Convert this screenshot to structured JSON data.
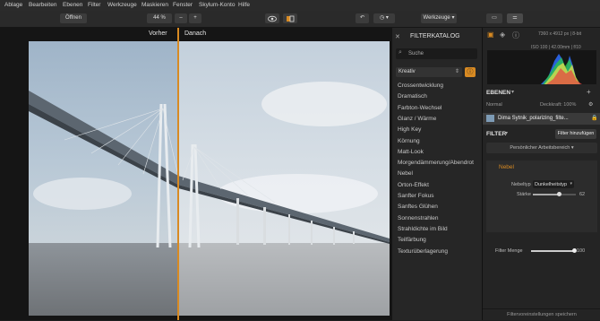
{
  "menu": [
    "Ablage",
    "Bearbeiten",
    "Ebenen",
    "Filter",
    "Werkzeuge",
    "Maskieren",
    "Fenster",
    "Skylum-Konto",
    "Hilfe"
  ],
  "toolbar": {
    "open_label": "Öffnen",
    "zoom": "44 %",
    "zoom_out": "–",
    "zoom_in": "+",
    "tools_label": "Werkzeuge"
  },
  "compare": {
    "before": "Vorher",
    "after": "Danach"
  },
  "catalog": {
    "title": "FILTERKATALOG",
    "search_placeholder": "Suche",
    "category": "Kreativ",
    "items": [
      "Crossentwicklung",
      "Dramatisch",
      "Farbton-Wechsel",
      "Glanz / Wärme",
      "High Key",
      "Körnung",
      "Matt-Look",
      "Morgendämmerung/Abendrot",
      "Nebel",
      "Orton-Effekt",
      "Sanfter Fokus",
      "Sanftes Glühen",
      "Sonnenstrahlen",
      "Strahldichte im Bild",
      "Teilfärbung",
      "Texturüberlagerung"
    ]
  },
  "info": {
    "dimensions": "7360 x 4912 px | 8-bit",
    "exif": "ISO 100 | 42.00mm | f/10"
  },
  "layers": {
    "title": "EBENEN",
    "blend": "Normal",
    "opacity": "Deckkraft: 100%",
    "layer_name": "Dima Sytnik_polarizing_filte..."
  },
  "filter": {
    "title": "FILTER",
    "add_button": "Filter hinzufügen",
    "workspace": "Persönlicher Arbeitsbereich",
    "active_filter": "Nebel",
    "type_label": "Nebeltyp",
    "type_value": "Dunkelheitstyp",
    "strength_label": "Stärke",
    "strength_value": "62",
    "amount_label": "Filter Menge",
    "amount_value": "100",
    "save_preset": "Filtervoreinstellungen speichern"
  },
  "colors": {
    "accent": "#d88a22"
  }
}
